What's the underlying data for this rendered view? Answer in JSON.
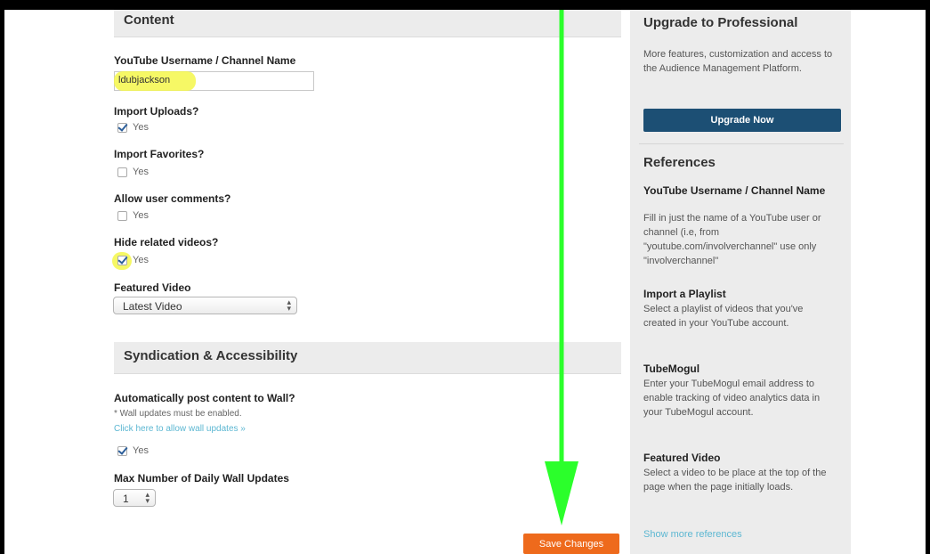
{
  "content_section": {
    "title": "Content",
    "username_label": "YouTube Username / Channel Name",
    "username_value": "ldubjackson",
    "import_uploads": {
      "label": "Import Uploads?",
      "option": "Yes",
      "checked": true
    },
    "import_favorites": {
      "label": "Import Favorites?",
      "option": "Yes",
      "checked": false
    },
    "allow_comments": {
      "label": "Allow user comments?",
      "option": "Yes",
      "checked": false
    },
    "hide_related": {
      "label": "Hide related videos?",
      "option": "Yes",
      "checked": true
    },
    "featured_video": {
      "label": "Featured Video",
      "selected": "Latest Video"
    }
  },
  "syndication_section": {
    "title": "Syndication & Accessibility",
    "auto_post_label": "Automatically post content to Wall?",
    "note": "* Wall updates must be enabled.",
    "link": "Click here to allow wall updates »",
    "auto_post_option": "Yes",
    "auto_post_checked": true,
    "max_updates_label": "Max Number of Daily Wall Updates",
    "max_updates_value": "1"
  },
  "save_button": "Save Changes",
  "sidebar": {
    "upgrade_title": "Upgrade to Professional",
    "upgrade_text": "More features, customization and access to the Audience Management Platform.",
    "upgrade_button": "Upgrade Now",
    "references_title": "References",
    "references": [
      {
        "title": "YouTube Username / Channel Name",
        "text": "Fill in just the name of a YouTube user or channel (i.e, from \"youtube.com/involverchannel\" use only \"involverchannel\""
      },
      {
        "title": "Import a Playlist",
        "text": "Select a playlist of videos that you've created in your YouTube account."
      },
      {
        "title": "TubeMogul",
        "text": "Enter your TubeMogul email address to enable tracking of video analytics data in your TubeMogul account."
      },
      {
        "title": "Featured Video",
        "text": "Select a video to be place at the top of the page when the page initially loads."
      }
    ],
    "more_link": "Show more references"
  },
  "colors": {
    "arrow": "#2bff2b",
    "save": "#ee6a1c",
    "upgrade": "#1c4f74",
    "highlight": "#f5f74a"
  }
}
